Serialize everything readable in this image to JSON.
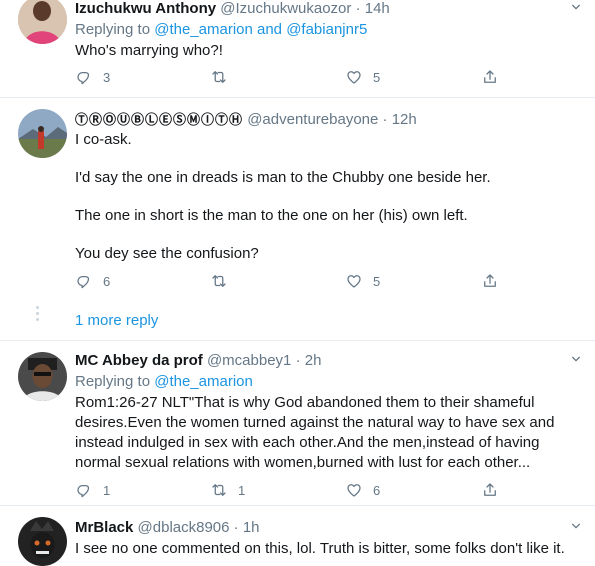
{
  "tweets": [
    {
      "name": "Izuchukwu Anthony",
      "handle": "@Izuchukwukaozor",
      "time": "14h",
      "replying_prefix": "Replying to",
      "replying_to": "@the_amarion and @fabianjnr5",
      "text": [
        "Who's marrying who?!"
      ],
      "replies": "3",
      "retweets": "",
      "likes": "5"
    },
    {
      "name": "ⓉⓇⓄⓊⒷⓁⒺⓈⓂⒾⓉⒽ",
      "handle": "@adventurebayone",
      "time": "12h",
      "text": [
        "I co-ask.",
        "I'd say the one in dreads is man to the Chubby one beside her.",
        "The one in short is the man to the one on her (his) own left.",
        "You dey see the confusion?"
      ],
      "replies": "6",
      "retweets": "",
      "likes": "5"
    },
    {
      "name": "MC Abbey da prof",
      "handle": "@mcabbey1",
      "time": "2h",
      "replying_prefix": "Replying to",
      "replying_to": "@the_amarion",
      "text": [
        "Rom1:26-27 NLT\"That is why God abandoned them to their shameful",
        "desires.Even the women turned against the natural way to have sex and",
        "instead indulged in sex with each other.And the men,instead of having",
        "normal sexual relations with women,burned with lust for each other..."
      ],
      "replies": "1",
      "retweets": "1",
      "likes": "6"
    },
    {
      "name": "MrBlack",
      "handle": "@dblack8906",
      "time": "1h",
      "text": [
        "I see no one commented on this, lol. Truth is bitter, some folks don't like it."
      ]
    }
  ],
  "more_replies": "1 more reply",
  "colors": {
    "accent": "#1b95e0",
    "secondary": "#657786",
    "divider": "#e6ecf0"
  }
}
